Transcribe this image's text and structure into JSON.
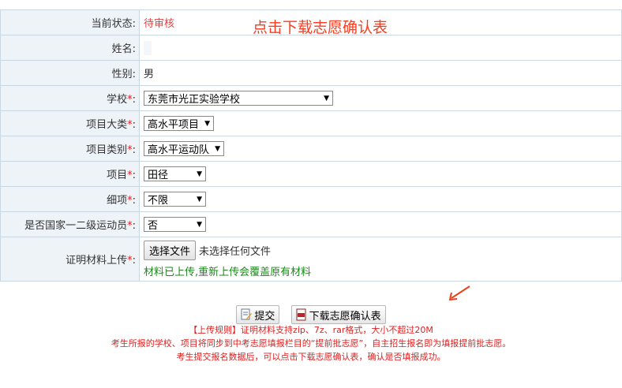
{
  "status_row": {
    "label": "当前状态:",
    "value": "待审核"
  },
  "download_link": "点击下载志愿确认表",
  "name_row": {
    "label": "姓名:",
    "value": ""
  },
  "gender_row": {
    "label": "性别:",
    "value": "男"
  },
  "school_row": {
    "label": "学校",
    "req": "*",
    "colon": ":",
    "value": "东莞市光正实验学校"
  },
  "category_row": {
    "label": "项目大类",
    "req": "*",
    "colon": ":",
    "value": "高水平项目"
  },
  "type_row": {
    "label": "项目类别",
    "req": "*",
    "colon": ":",
    "value": "高水平运动队"
  },
  "project_row": {
    "label": "项目",
    "req": "*",
    "colon": ":",
    "value": "田径"
  },
  "subitem_row": {
    "label": "细项",
    "req": "*",
    "colon": ":",
    "value": "不限"
  },
  "athlete_row": {
    "label": "是否国家一二级运动员",
    "req": "*",
    "colon": ":",
    "value": "否"
  },
  "upload_row": {
    "label": "证明材料上传",
    "req": "*",
    "colon": ":",
    "button": "选择文件",
    "no_file": "未选择任何文件",
    "uploaded_note": "材料已上传,重新上传会覆盖原有材料"
  },
  "buttons": {
    "submit": "提交",
    "download": "下载志愿确认表"
  },
  "rules": [
    "【上传规则】证明材料支持zip、7z、rar格式，大小不超过20M",
    "考生所报的学校、项目将同步到中考志愿填报栏目的“提前批志愿”，自主招生报名即为填报提前批志愿。",
    "考生提交报名数据后，可以点击下载志愿确认表，确认是否填报成功。"
  ],
  "colors": {
    "label_bg": "#eef3f8",
    "border": "#c9d7e3",
    "red": "#e02020",
    "link": "#ff3a1c",
    "green": "#1a8a1a"
  }
}
